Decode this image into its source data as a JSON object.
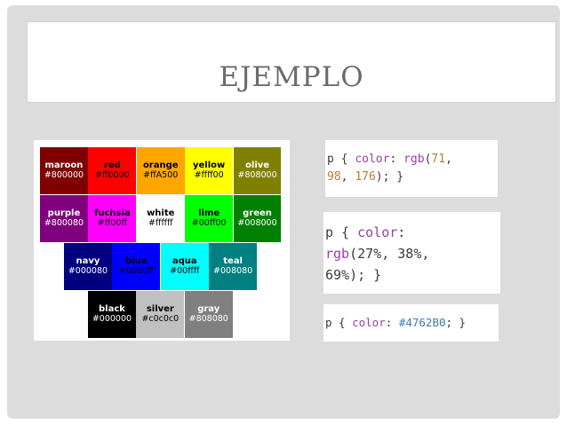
{
  "slide": {
    "title": "EJEMPLO"
  },
  "colors": {
    "rows": [
      [
        {
          "name": "maroon",
          "hex": "#800000",
          "bg": "#800000",
          "fg": "#ffffff"
        },
        {
          "name": "red",
          "hex": "#ff0000",
          "bg": "#ff0000",
          "fg": "#000000"
        },
        {
          "name": "orange",
          "hex": "#ffA500",
          "bg": "#ffa500",
          "fg": "#000000"
        },
        {
          "name": "yellow",
          "hex": "#ffff00",
          "bg": "#ffff00",
          "fg": "#000000"
        },
        {
          "name": "olive",
          "hex": "#808000",
          "bg": "#808000",
          "fg": "#ffffff"
        }
      ],
      [
        {
          "name": "purple",
          "hex": "#800080",
          "bg": "#800080",
          "fg": "#ffffff"
        },
        {
          "name": "fuchsia",
          "hex": "#ff00ff",
          "bg": "#ff00ff",
          "fg": "#000000"
        },
        {
          "name": "white",
          "hex": "#ffffff",
          "bg": "#ffffff",
          "fg": "#000000"
        },
        {
          "name": "lime",
          "hex": "#00ff00",
          "bg": "#00ff00",
          "fg": "#000000"
        },
        {
          "name": "green",
          "hex": "#008000",
          "bg": "#008000",
          "fg": "#ffffff"
        }
      ],
      [
        {
          "name": "navy",
          "hex": "#000080",
          "bg": "#000080",
          "fg": "#ffffff"
        },
        {
          "name": "blue",
          "hex": "#0000ff",
          "bg": "#0000ff",
          "fg": "#000000"
        },
        {
          "name": "aqua",
          "hex": "#00ffff",
          "bg": "#00ffff",
          "fg": "#000000"
        },
        {
          "name": "teal",
          "hex": "#008080",
          "bg": "#008080",
          "fg": "#ffffff"
        }
      ],
      [
        {
          "name": "black",
          "hex": "#000000",
          "bg": "#000000",
          "fg": "#ffffff"
        },
        {
          "name": "silver",
          "hex": "#c0c0c0",
          "bg": "#c0c0c0",
          "fg": "#000000"
        },
        {
          "name": "gray",
          "hex": "#808080",
          "bg": "#808080",
          "fg": "#ffffff"
        }
      ]
    ]
  },
  "code": {
    "rgb_example": {
      "selector": "p",
      "property": "color",
      "func": "rgb",
      "values": [
        "71",
        "98",
        "176"
      ]
    },
    "percent_example": {
      "selector": "p",
      "property": "color",
      "func": "rgb",
      "values": [
        "27%",
        "38%",
        "69%"
      ]
    },
    "hex_example": {
      "selector": "p",
      "property": "color",
      "value": "#4762B0"
    }
  }
}
